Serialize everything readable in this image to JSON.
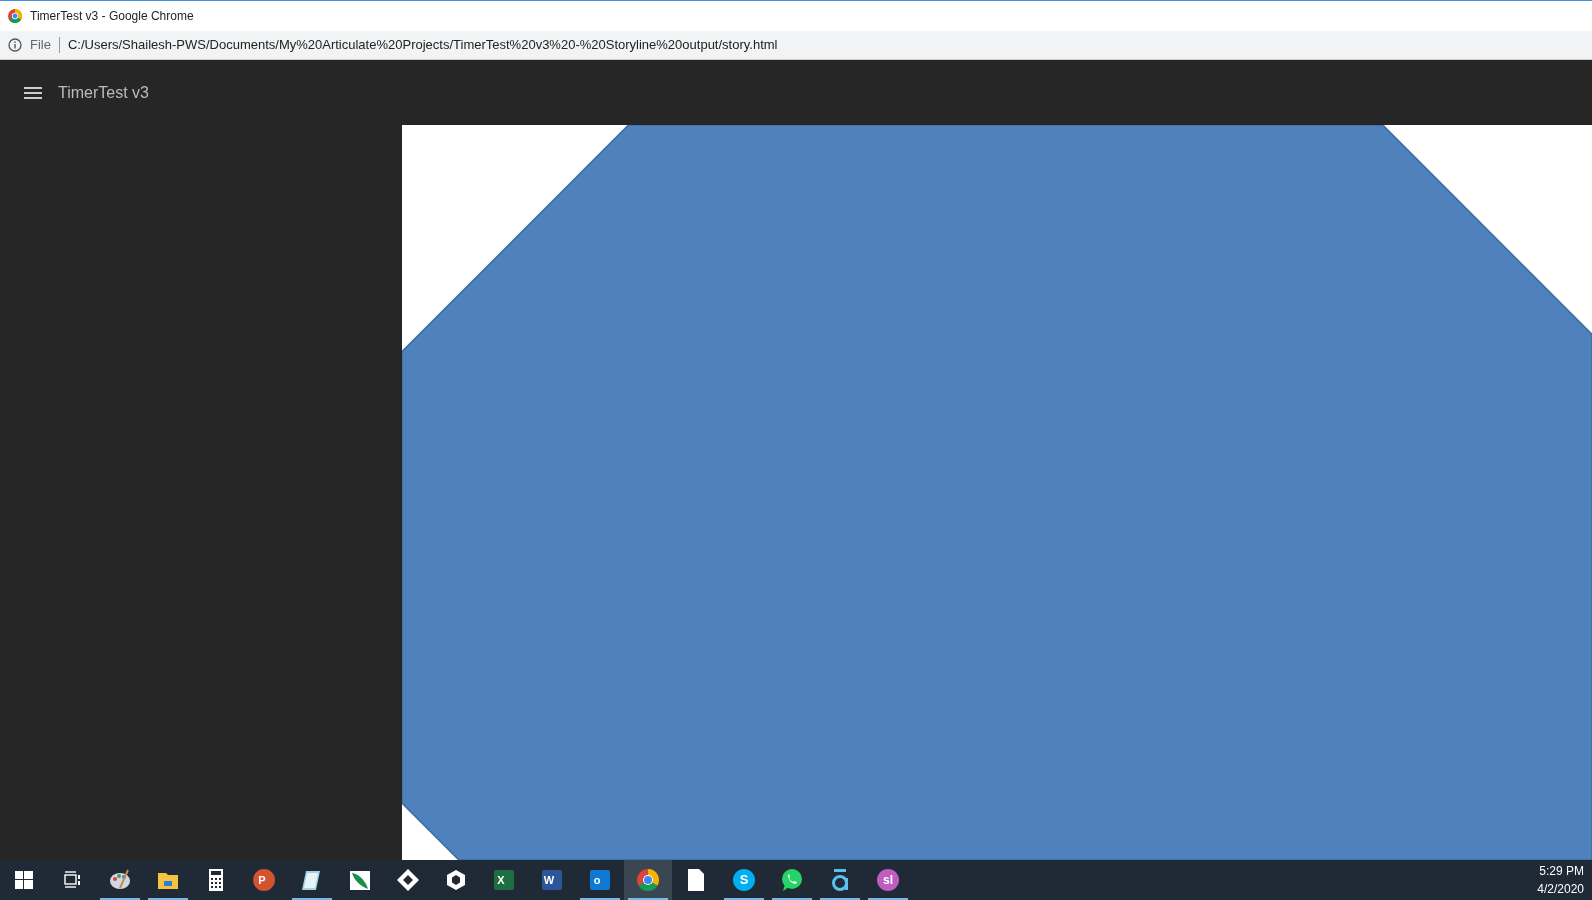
{
  "browser": {
    "window_title": "TimerTest v3 - Google Chrome",
    "address_prefix": "File",
    "url": "C:/Users/Shailesh-PWS/Documents/My%20Articulate%20Projects/TimerTest%20v3%20-%20Storyline%20output/story.html"
  },
  "app": {
    "title": "TimerTest v3"
  },
  "taskbar": {
    "apps": [
      {
        "kind": "paint",
        "running": true,
        "selected": false
      },
      {
        "kind": "folder",
        "running": true,
        "selected": false
      },
      {
        "kind": "calculator",
        "running": false,
        "selected": false
      },
      {
        "kind": "powerpoint",
        "label": "P",
        "running": false,
        "selected": false
      },
      {
        "kind": "notepad",
        "running": true,
        "selected": false
      },
      {
        "kind": "feather",
        "running": false,
        "selected": false
      },
      {
        "kind": "diamond",
        "running": false,
        "selected": false
      },
      {
        "kind": "cube",
        "running": false,
        "selected": false
      },
      {
        "kind": "excel",
        "label": "X",
        "running": false,
        "selected": false
      },
      {
        "kind": "word",
        "label": "W",
        "running": false,
        "selected": false
      },
      {
        "kind": "outlook",
        "label": "o",
        "running": true,
        "selected": false
      },
      {
        "kind": "chrome",
        "running": true,
        "selected": true
      },
      {
        "kind": "file",
        "running": false,
        "selected": false
      },
      {
        "kind": "skype",
        "label": "S",
        "running": true,
        "selected": false
      },
      {
        "kind": "whatsapp",
        "running": true,
        "selected": false
      },
      {
        "kind": "a-app",
        "running": true,
        "selected": false
      },
      {
        "kind": "circle-app",
        "label": "sl",
        "running": true,
        "selected": false
      }
    ],
    "clock": {
      "time": "5:29 PM",
      "date": "4/2/2020"
    }
  }
}
